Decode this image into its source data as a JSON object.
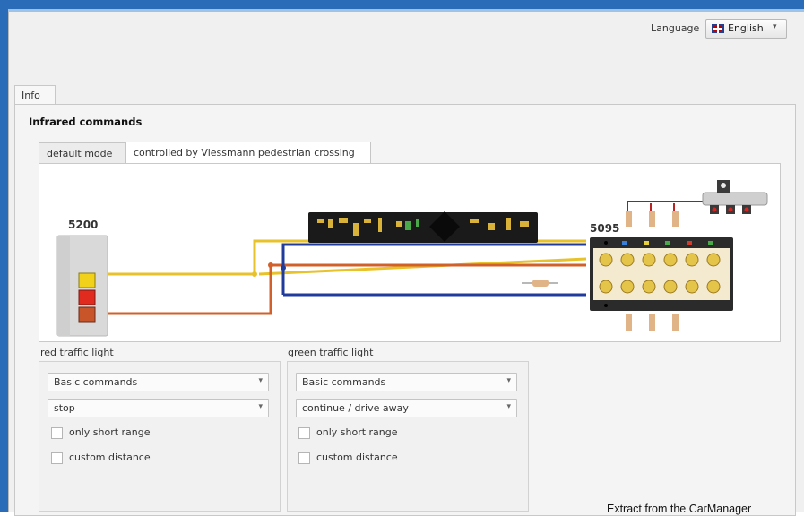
{
  "header": {
    "language_label": "Language",
    "language_value": "English",
    "language_flag": "uk-flag-icon"
  },
  "tabs_top": [
    "Info"
  ],
  "section": {
    "title": "Infrared commands",
    "tabs": [
      {
        "label": "default mode",
        "active": false
      },
      {
        "label": "controlled by Viessmann pedestrian crossing",
        "active": true
      }
    ]
  },
  "diagram": {
    "left_device_label": "5200",
    "right_device_label": "5095",
    "wire_colors": {
      "yellow": "#e8c22a",
      "orange": "#d2602a",
      "blue": "#1f3c9c",
      "brown": "#7a3d26"
    }
  },
  "groups": [
    {
      "title": "red traffic light",
      "command_type": "Basic commands",
      "command": "stop",
      "options": [
        {
          "label": "only short range",
          "checked": false
        },
        {
          "label": "custom distance",
          "checked": false
        }
      ]
    },
    {
      "title": "green traffic light",
      "command_type": "Basic commands",
      "command": "continue / drive away",
      "options": [
        {
          "label": "only short range",
          "checked": false
        },
        {
          "label": "custom distance",
          "checked": false
        }
      ]
    }
  ],
  "caption": "Extract from the CarManager"
}
